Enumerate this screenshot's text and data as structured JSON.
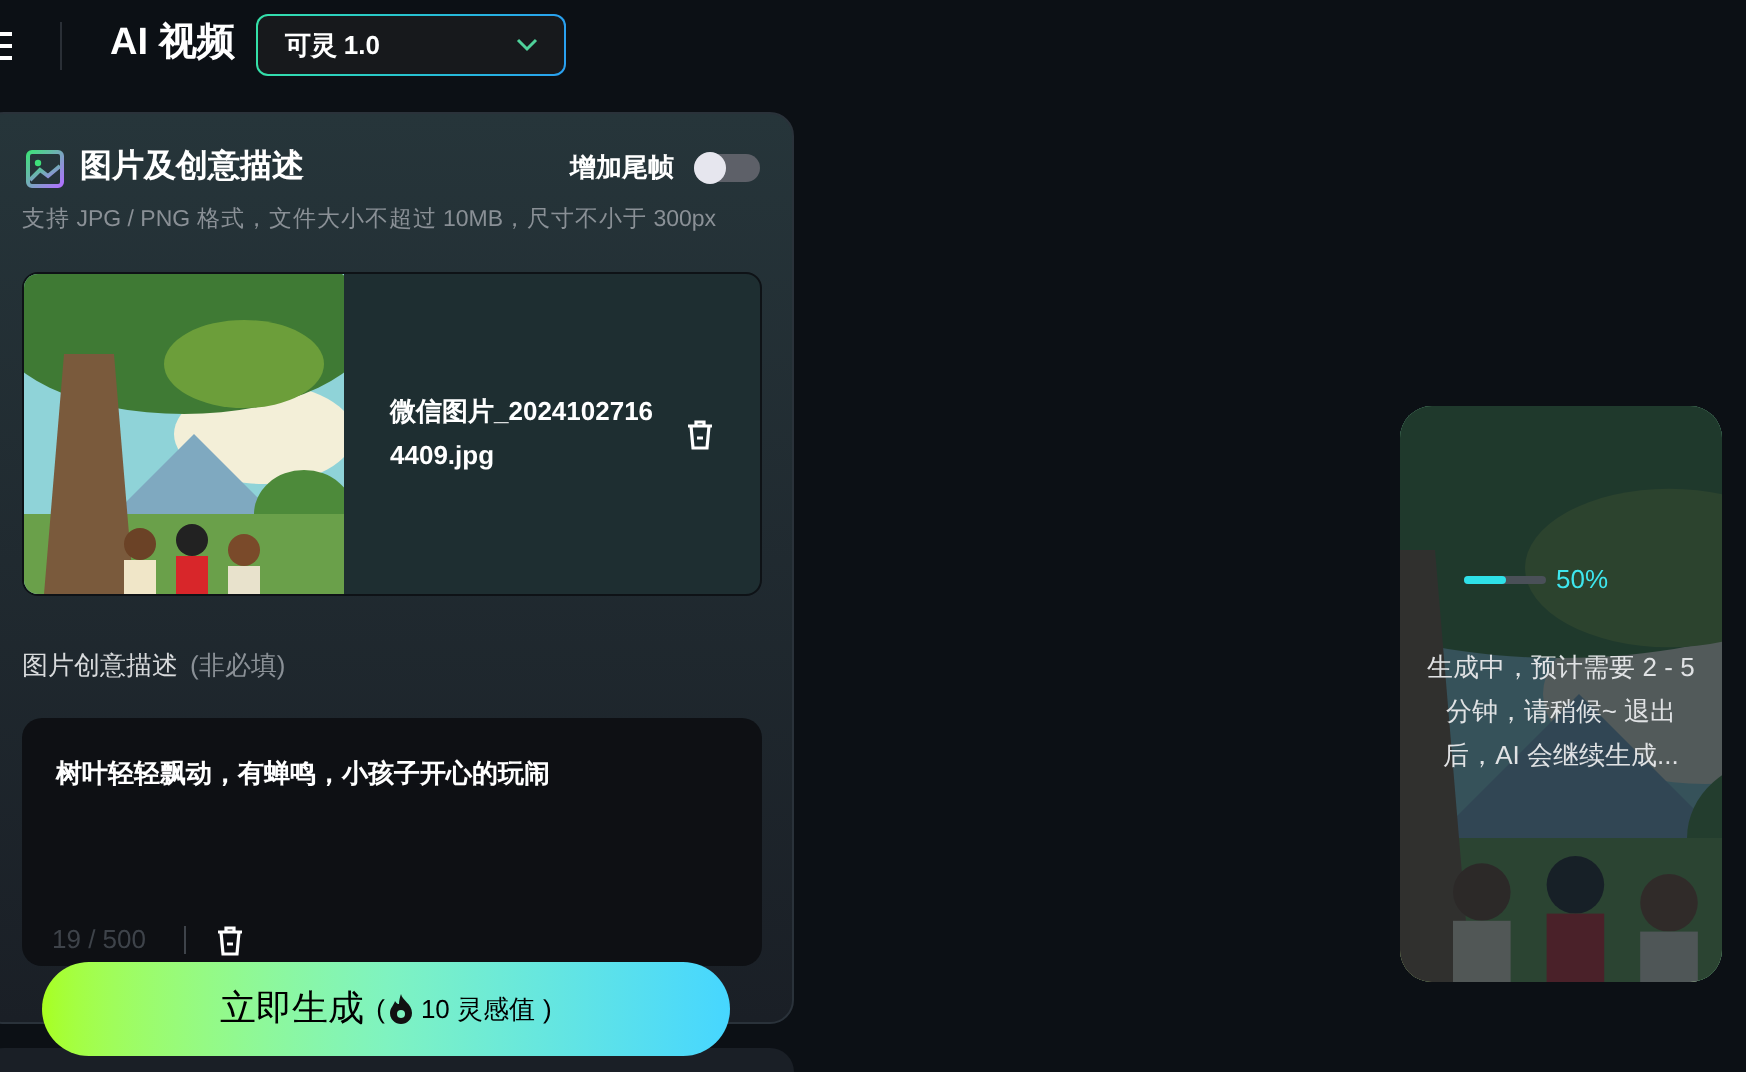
{
  "header": {
    "title": "AI 视频",
    "model_select": {
      "value": "可灵 1.0"
    }
  },
  "image_section": {
    "title": "图片及创意描述",
    "end_frame_toggle": {
      "label": "增加尾帧",
      "on": false
    },
    "hint": "支持 JPG / PNG 格式，文件大小不超过 10MB，尺寸不小于 300px",
    "upload": {
      "filename": "微信图片_20241027164409.jpg"
    }
  },
  "description": {
    "label": "图片创意描述",
    "optional": "(非必填)",
    "value": "树叶轻轻飘动，有蝉鸣，小孩子开心的玩闹",
    "counter": "19 / 500"
  },
  "generate_button": {
    "label": "立即生成",
    "cost_open": "(",
    "cost": "10 灵感值",
    "cost_close": ")"
  },
  "progress_card": {
    "level": 0.5,
    "percent": "50%",
    "message": "生成中，预计需要 2 - 5 分钟，请稍候~ 退出后，AI 会继续生成..."
  }
}
